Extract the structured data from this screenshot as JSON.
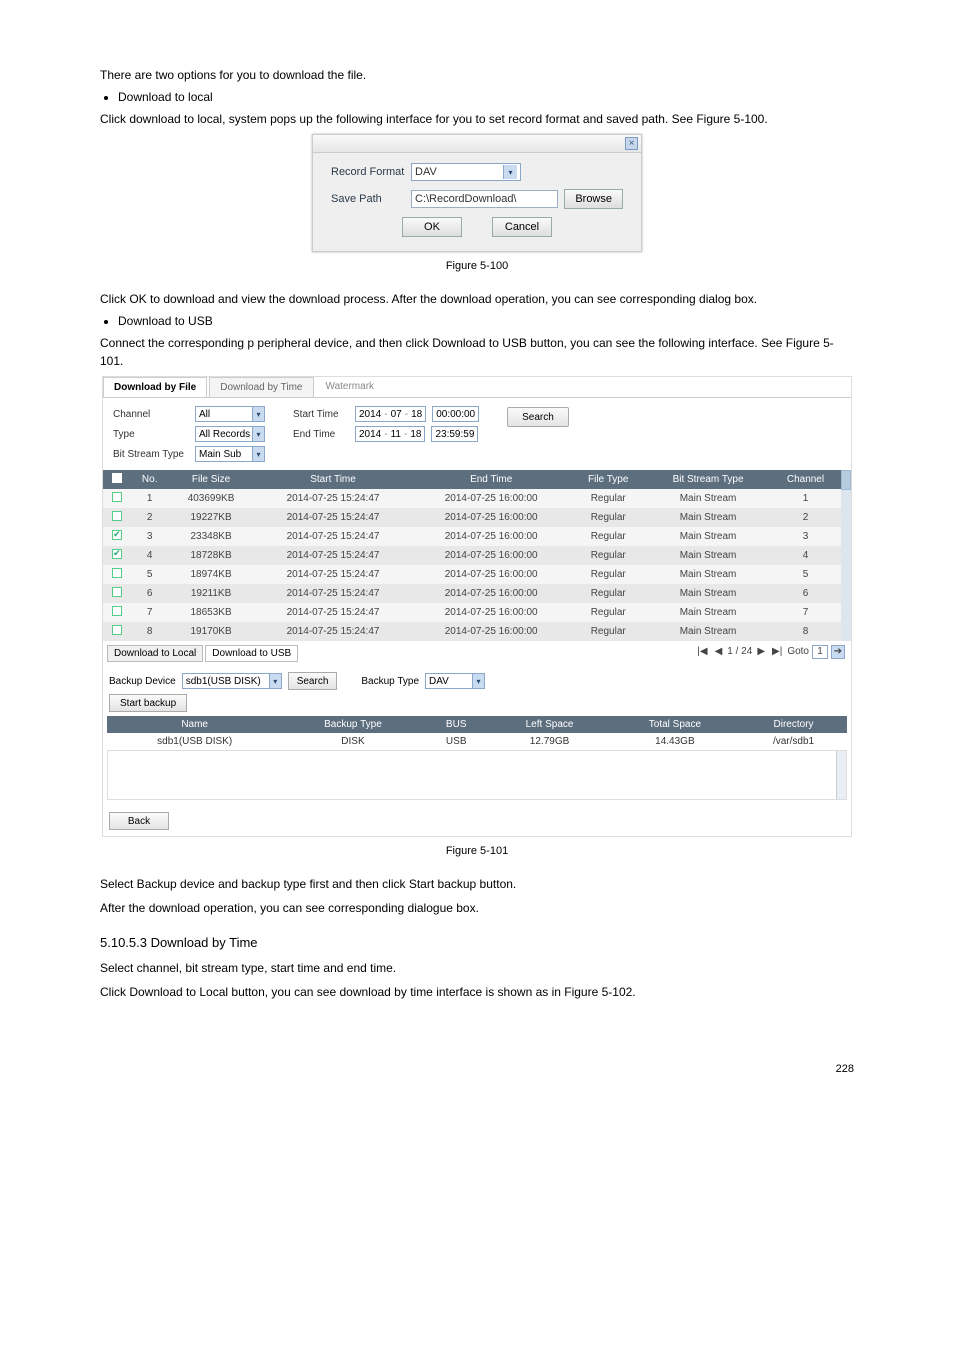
{
  "para1": "There are two options for you to download the file.",
  "bullet1": "Download to local",
  "para_dl_local": "Click download to local, system pops up the following interface for you to set record format and saved path. See Figure 5-100.",
  "dlg": {
    "close": "×",
    "rec_format_label": "Record Format",
    "rec_format_value": "DAV",
    "save_path_label": "Save Path",
    "save_path_value": "C:\\RecordDownload\\",
    "browse": "Browse",
    "ok": "OK",
    "cancel": "Cancel"
  },
  "fig100": "Figure 5-100",
  "para_ok": "Click OK to download and view the download process. After the download operation, you can see corresponding dialog box.",
  "bullet2": "Download to USB",
  "para_usb": "Connect the corresponding p peripheral device, and then click Download to USB button, you can see the following interface. See Figure 5-101.",
  "panel": {
    "tab_file": "Download by File",
    "tab_time": "Download by Time",
    "tab_wm": "Watermark",
    "channel_label": "Channel",
    "channel_value": "All",
    "type_label": "Type",
    "type_value": "All Records",
    "bst_label": "Bit Stream Type",
    "bst_value": "Main Sub",
    "start_label": "Start Time",
    "end_label": "End Time",
    "start_date": {
      "y": "2014",
      "m": "07",
      "d": "18",
      "h": "00",
      "mm": "00",
      "s": "00"
    },
    "end_date": {
      "y": "2014",
      "m": "11",
      "d": "18",
      "h": "23",
      "mm": "59",
      "s": "59"
    },
    "search": "Search",
    "headers": [
      "",
      "No.",
      "File Size",
      "Start Time",
      "End Time",
      "File Type",
      "Bit Stream Type",
      "Channel"
    ],
    "rows": [
      {
        "chk": false,
        "no": "1",
        "size": "403699KB",
        "st": "2014-07-25 15:24:47",
        "et": "2014-07-25 16:00:00",
        "ft": "Regular",
        "bst": "Main Stream",
        "ch": "1"
      },
      {
        "chk": false,
        "no": "2",
        "size": "19227KB",
        "st": "2014-07-25 15:24:47",
        "et": "2014-07-25 16:00:00",
        "ft": "Regular",
        "bst": "Main Stream",
        "ch": "2"
      },
      {
        "chk": true,
        "no": "3",
        "size": "23348KB",
        "st": "2014-07-25 15:24:47",
        "et": "2014-07-25 16:00:00",
        "ft": "Regular",
        "bst": "Main Stream",
        "ch": "3"
      },
      {
        "chk": true,
        "no": "4",
        "size": "18728KB",
        "st": "2014-07-25 15:24:47",
        "et": "2014-07-25 16:00:00",
        "ft": "Regular",
        "bst": "Main Stream",
        "ch": "4"
      },
      {
        "chk": false,
        "no": "5",
        "size": "18974KB",
        "st": "2014-07-25 15:24:47",
        "et": "2014-07-25 16:00:00",
        "ft": "Regular",
        "bst": "Main Stream",
        "ch": "5"
      },
      {
        "chk": false,
        "no": "6",
        "size": "19211KB",
        "st": "2014-07-25 15:24:47",
        "et": "2014-07-25 16:00:00",
        "ft": "Regular",
        "bst": "Main Stream",
        "ch": "6"
      },
      {
        "chk": false,
        "no": "7",
        "size": "18653KB",
        "st": "2014-07-25 15:24:47",
        "et": "2014-07-25 16:00:00",
        "ft": "Regular",
        "bst": "Main Stream",
        "ch": "7"
      },
      {
        "chk": false,
        "no": "8",
        "size": "19170KB",
        "st": "2014-07-25 15:24:47",
        "et": "2014-07-25 16:00:00",
        "ft": "Regular",
        "bst": "Main Stream",
        "ch": "8"
      }
    ],
    "dl_local_tab": "Download to Local",
    "dl_usb_tab": "Download to USB",
    "pager_page": "1 / 24",
    "pager_first": "|◀",
    "pager_prev": "◀",
    "pager_next": "▶",
    "pager_last": "▶|",
    "goto_label": "Goto",
    "goto_value": "1",
    "goto_go": "➔",
    "backup_device_label": "Backup Device",
    "backup_device_value": "sdb1(USB DISK)",
    "backup_search": "Search",
    "backup_type_label": "Backup Type",
    "backup_type_value": "DAV",
    "start_backup": "Start backup",
    "dev_headers": [
      "Name",
      "Backup Type",
      "BUS",
      "Left Space",
      "Total Space",
      "Directory"
    ],
    "dev_row": {
      "name": "sdb1(USB DISK)",
      "btype": "DISK",
      "bus": "USB",
      "left": "12.79GB",
      "total": "14.43GB",
      "dir": "/var/sdb1"
    },
    "back": "Back"
  },
  "fig101": "Figure 5-101",
  "para_after": "Select Backup device and backup type first and then click Start backup button.",
  "para_after2": "After the download operation, you can see corresponding dialogue box.",
  "sec_title": "5.10.5.3 Download by Time",
  "sec_para": "Select channel, bit stream type, start time and end time.",
  "sec_para2": "Click Download to Local button, you can see download by time interface is shown as in Figure 5-102.",
  "pageno": "228"
}
